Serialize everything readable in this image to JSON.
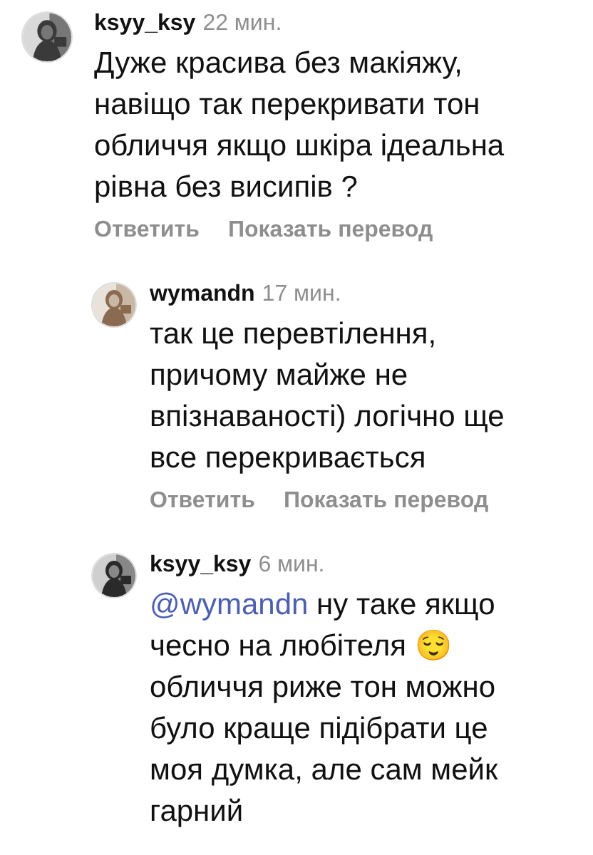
{
  "comments": [
    {
      "kind": "comment",
      "username": "ksyy_ksy",
      "time": "22 мин.",
      "text": "Дуже красива без макіяжу,\nнавіщо так перекривати тон\nобличчя якщо шкіра ідеальна\nрівна без висипів ?",
      "actions": [
        "Ответить",
        "Показать перевод"
      ]
    },
    {
      "kind": "reply",
      "username": "wymandn",
      "time": "17 мин.",
      "text": "так це перевтілення,\nпричому майже не\nвпізнаваності) логічно ще\nвсе перекривається",
      "actions": [
        "Ответить",
        "Показать перевод"
      ]
    },
    {
      "kind": "reply",
      "username": "ksyy_ksy",
      "time": "6 мин.",
      "mention": "@wymandn",
      "text": " ну таке якщо\nчесно на любітеля 😌\nобличчя риже тон можно\nбуло краще підібрати це\nмоя думка, але сам мейк\nгарний"
    }
  ]
}
